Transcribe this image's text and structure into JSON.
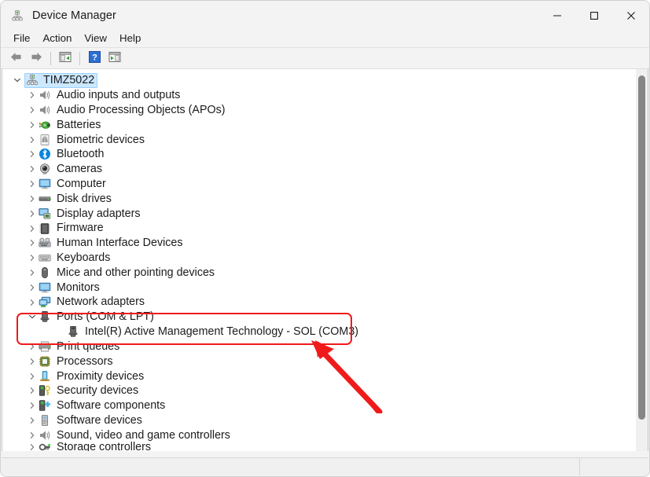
{
  "window": {
    "title": "Device Manager",
    "title_icon": "device-manager-icon",
    "controls": {
      "minimize": "Minimize",
      "maximize": "Maximize",
      "close": "Close"
    }
  },
  "menubar": {
    "items": [
      {
        "label": "File",
        "name": "menu-file"
      },
      {
        "label": "Action",
        "name": "menu-action"
      },
      {
        "label": "View",
        "name": "menu-view"
      },
      {
        "label": "Help",
        "name": "menu-help"
      }
    ]
  },
  "toolbar": {
    "buttons": [
      {
        "name": "back-button",
        "icon": "arrow-left-icon",
        "label": "Back"
      },
      {
        "name": "forward-button",
        "icon": "arrow-right-icon",
        "label": "Forward"
      },
      {
        "name": "show-hide-console-tree-button",
        "icon": "console-tree-icon",
        "label": "Show/Hide Console Tree"
      },
      {
        "name": "help-button",
        "icon": "question-mark-icon",
        "label": "Help"
      },
      {
        "name": "show-hide-action-pane-button",
        "icon": "action-pane-icon",
        "label": "Show/Hide Action Pane"
      }
    ]
  },
  "tree": {
    "root": {
      "label": "TIMZ5022",
      "icon": "computer-root-icon",
      "selected": true,
      "expanded": true
    },
    "items": [
      {
        "label": "Audio inputs and outputs",
        "icon": "speaker-icon",
        "expanded": false,
        "depth": 1
      },
      {
        "label": "Audio Processing Objects (APOs)",
        "icon": "speaker-icon",
        "expanded": false,
        "depth": 1
      },
      {
        "label": "Batteries",
        "icon": "battery-icon",
        "expanded": false,
        "depth": 1
      },
      {
        "label": "Biometric devices",
        "icon": "fingerprint-icon",
        "expanded": false,
        "depth": 1
      },
      {
        "label": "Bluetooth",
        "icon": "bluetooth-icon",
        "expanded": false,
        "depth": 1
      },
      {
        "label": "Cameras",
        "icon": "camera-icon",
        "expanded": false,
        "depth": 1
      },
      {
        "label": "Computer",
        "icon": "monitor-icon",
        "expanded": false,
        "depth": 1
      },
      {
        "label": "Disk drives",
        "icon": "disk-drive-icon",
        "expanded": false,
        "depth": 1
      },
      {
        "label": "Display adapters",
        "icon": "display-adapter-icon",
        "expanded": false,
        "depth": 1
      },
      {
        "label": "Firmware",
        "icon": "firmware-chip-icon",
        "expanded": false,
        "depth": 1
      },
      {
        "label": "Human Interface Devices",
        "icon": "hid-icon",
        "expanded": false,
        "depth": 1
      },
      {
        "label": "Keyboards",
        "icon": "keyboard-icon",
        "expanded": false,
        "depth": 1
      },
      {
        "label": "Mice and other pointing devices",
        "icon": "mouse-icon",
        "expanded": false,
        "depth": 1
      },
      {
        "label": "Monitors",
        "icon": "monitor-icon",
        "expanded": false,
        "depth": 1
      },
      {
        "label": "Network adapters",
        "icon": "network-adapter-icon",
        "expanded": false,
        "depth": 1
      },
      {
        "label": "Ports (COM & LPT)",
        "icon": "port-icon",
        "expanded": true,
        "depth": 1,
        "highlighted": true
      },
      {
        "label": "Intel(R) Active Management Technology - SOL (COM3)",
        "icon": "port-icon",
        "leaf": true,
        "depth": 2,
        "highlighted": true
      },
      {
        "label": "Print queues",
        "icon": "printer-icon",
        "expanded": false,
        "depth": 1
      },
      {
        "label": "Processors",
        "icon": "processor-icon",
        "expanded": false,
        "depth": 1
      },
      {
        "label": "Proximity devices",
        "icon": "proximity-icon",
        "expanded": false,
        "depth": 1
      },
      {
        "label": "Security devices",
        "icon": "security-key-icon",
        "expanded": false,
        "depth": 1
      },
      {
        "label": "Software components",
        "icon": "software-component-icon",
        "expanded": false,
        "depth": 1
      },
      {
        "label": "Software devices",
        "icon": "software-device-icon",
        "expanded": false,
        "depth": 1
      },
      {
        "label": "Sound, video and game controllers",
        "icon": "speaker-icon",
        "expanded": false,
        "depth": 1
      },
      {
        "label": "Storage controllers",
        "icon": "storage-controller-icon",
        "expanded": false,
        "depth": 1,
        "clipped": true
      }
    ]
  },
  "scrollbar": {
    "name": "vertical-scrollbar",
    "orientation": "vertical"
  },
  "statusbar": {
    "pane1": "",
    "pane2": ""
  },
  "annotations": {
    "highlight_box": {
      "color": "#ef1b1b",
      "target": "Ports (COM & LPT) / Intel(R) Active Management Technology - SOL (COM3)"
    },
    "arrow": {
      "color": "#ef1b1b",
      "direction": "up-left"
    }
  },
  "colors": {
    "selection_fill": "#cce8ff",
    "selection_border": "#99d1ff",
    "annotation_red": "#ef1b1b",
    "window_chrome": "#f3f3f3",
    "tree_background": "#ffffff"
  }
}
